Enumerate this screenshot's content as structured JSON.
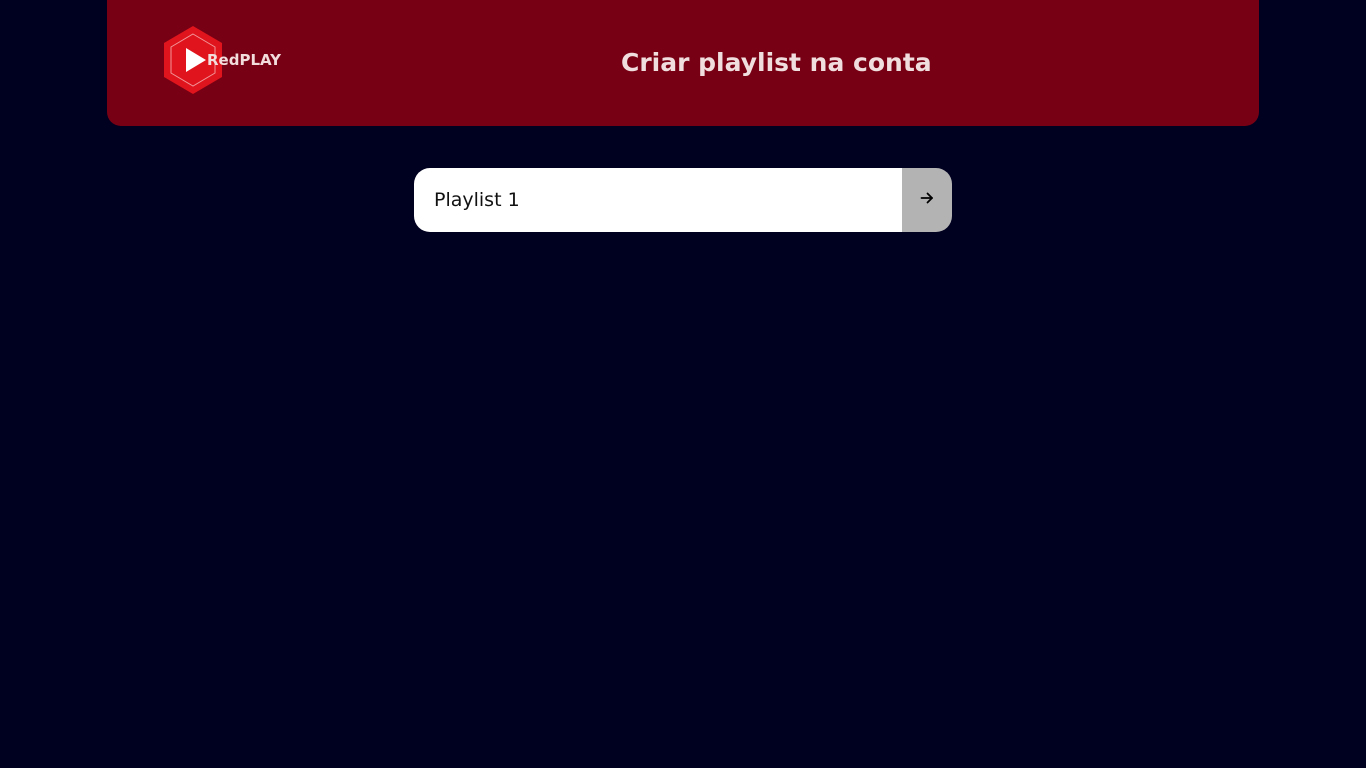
{
  "header": {
    "logo_text": "RedPLAY",
    "title": "Criar playlist na conta"
  },
  "form": {
    "input_value": "Playlist 1",
    "submit_icon": "arrow-right-icon"
  },
  "colors": {
    "background": "#000020",
    "header": "#780014",
    "logo_red": "#e0141c",
    "button": "#b3b3b3"
  }
}
